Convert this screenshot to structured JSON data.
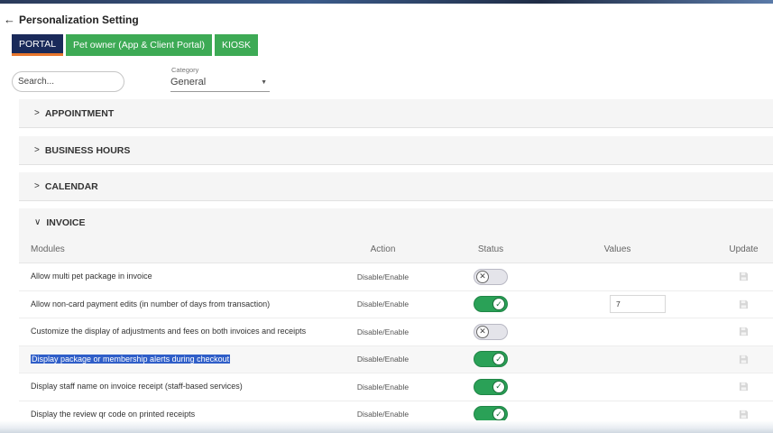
{
  "header": {
    "back_icon": "←",
    "title": "Personalization Setting"
  },
  "tabs": [
    {
      "label": "PORTAL",
      "active": true
    },
    {
      "label": "Pet owner (App & Client Portal)",
      "active": false
    },
    {
      "label": "KIOSK",
      "active": false
    }
  ],
  "search": {
    "placeholder": "Search..."
  },
  "category": {
    "label": "Category",
    "value": "General"
  },
  "sections": [
    {
      "label": "APPOINTMENT",
      "chevron": ">"
    },
    {
      "label": "BUSINESS HOURS",
      "chevron": ">"
    },
    {
      "label": "CALENDAR",
      "chevron": ">"
    },
    {
      "label": "INVOICE",
      "chevron": "∨"
    }
  ],
  "table": {
    "headers": {
      "modules": "Modules",
      "action": "Action",
      "status": "Status",
      "values": "Values",
      "update": "Update"
    },
    "rows": [
      {
        "module": "Allow multi pet package in invoice",
        "action": "Disable/Enable",
        "status": "off",
        "value": ""
      },
      {
        "module": "Allow non-card payment edits (in number of days from transaction)",
        "action": "Disable/Enable",
        "status": "on",
        "value": "7"
      },
      {
        "module": "Customize the display of adjustments and fees on both invoices and receipts",
        "action": "Disable/Enable",
        "status": "off",
        "value": ""
      },
      {
        "module": "Display package or membership alerts during checkout",
        "action": "Disable/Enable",
        "status": "on",
        "value": "",
        "highlighted": true
      },
      {
        "module": "Display staff name on invoice receipt (staff-based services)",
        "action": "Disable/Enable",
        "status": "on",
        "value": ""
      },
      {
        "module": "Display the review qr code on printed receipts",
        "action": "Disable/Enable",
        "status": "on",
        "value": ""
      }
    ]
  },
  "colors": {
    "active_tab": "#1a2a5a",
    "tab": "#3daa55",
    "toggle_on": "#2aa157",
    "highlight": "#2f5ec8",
    "active_tab_underline": "#e8762c"
  }
}
